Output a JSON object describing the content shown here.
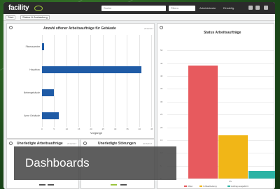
{
  "app": {
    "logo": "facility"
  },
  "topbar": {
    "search_placeholder": "Suche",
    "filter_placeholder": "Filtern",
    "user": "Administrator",
    "menu": "Einstellg."
  },
  "tabs": [
    {
      "label": "Start"
    },
    {
      "label": "Status & Auslastung"
    }
  ],
  "panels": {
    "work_orders_by_building": {
      "title": "Anzahl offener Arbeitsaufträge für Gebäude",
      "meta": "2016/4/17",
      "x_axis_label": "Vorgänge"
    },
    "work_order_status": {
      "title": "Status Arbeitsaufträge"
    },
    "overdue_orders": {
      "title": "Unerledigte Arbeitsaufträge",
      "meta": "2016/4/17"
    },
    "open_faults": {
      "title": "Unerledigte Störungen",
      "meta": "2016/4/17"
    }
  },
  "chart_data": [
    {
      "type": "bar",
      "orientation": "horizontal",
      "title": "Anzahl offener Arbeitsaufträge für Gebäude",
      "xlabel": "Vorgänge",
      "categories": [
        "Fitnesscenter",
        "Hauptbau",
        "Nebengebäude",
        "Anne Gebäude"
      ],
      "values": [
        1,
        41,
        5,
        7
      ],
      "xlim": [
        0,
        45
      ],
      "grid": true
    },
    {
      "type": "bar",
      "title": "Status Arbeitsaufträge",
      "categories": [
        "FS"
      ],
      "series": [
        {
          "name": "Offen",
          "values": [
            44
          ],
          "color": "#e75a5e"
        },
        {
          "name": "In Bearbeitung",
          "values": [
            17
          ],
          "color": "#f1b617"
        },
        {
          "name": "Auftrag ausgeführt",
          "values": [
            3
          ],
          "color": "#2bb3a4"
        }
      ],
      "ylim": [
        0,
        55
      ],
      "yticks": [
        0,
        5,
        10,
        15,
        20,
        25,
        30,
        35,
        40,
        45,
        50
      ],
      "legend": "bottom"
    }
  ],
  "caption": {
    "text": "Dashboards"
  }
}
